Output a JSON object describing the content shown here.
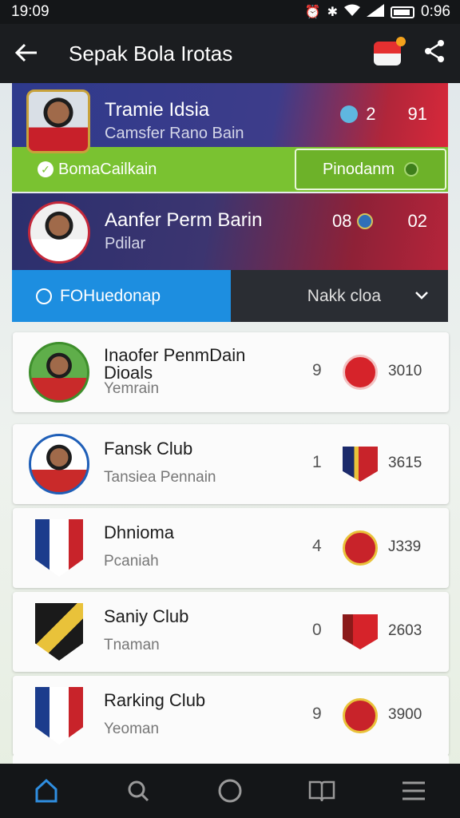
{
  "status_bar": {
    "time": "19:09",
    "battery": "0:96"
  },
  "app_bar": {
    "title": "Sepak Bola Irotas"
  },
  "featured": [
    {
      "name": "Tramie Idsia",
      "subtitle": "Camsfer Rano Bain",
      "stat1": "2",
      "stat2": "91",
      "action_left": "BomaCailkain",
      "action_right": "Pinodanm"
    },
    {
      "name": "Aanfer Perm Barin",
      "subtitle": "Pdilar",
      "stat1": "08",
      "stat2": "02",
      "action_left": "FOHuedonap",
      "action_right": "Nakk cloa"
    }
  ],
  "list": [
    {
      "name": "Inaofer PenmDain\nDioals",
      "subtitle": "Yemrain",
      "rank": "9",
      "score": "3010"
    },
    {
      "name": "Fansk Club",
      "subtitle": "Tansiea Pennain",
      "rank": "1",
      "score": "3615"
    },
    {
      "name": "Dhnioma",
      "subtitle": "Pcaniah",
      "rank": "4",
      "score": "J339"
    },
    {
      "name": "Saniy Club",
      "subtitle": "Tnaman",
      "rank": "0",
      "score": "2603"
    },
    {
      "name": "Rarking Club",
      "subtitle": "Yeoman",
      "rank": "9",
      "score": "3900"
    }
  ],
  "colors": {
    "accent_green": "#7ac231",
    "accent_blue": "#1d8ee0",
    "banner_navy": "#2e3a8c",
    "banner_red": "#d8283a",
    "dark_bar": "#141618"
  },
  "icons": {
    "back": "arrow-left-icon",
    "flag": "flag-icon",
    "share": "share-icon",
    "nav": [
      "home-icon",
      "search-icon",
      "circle-icon",
      "book-icon",
      "menu-icon"
    ]
  }
}
